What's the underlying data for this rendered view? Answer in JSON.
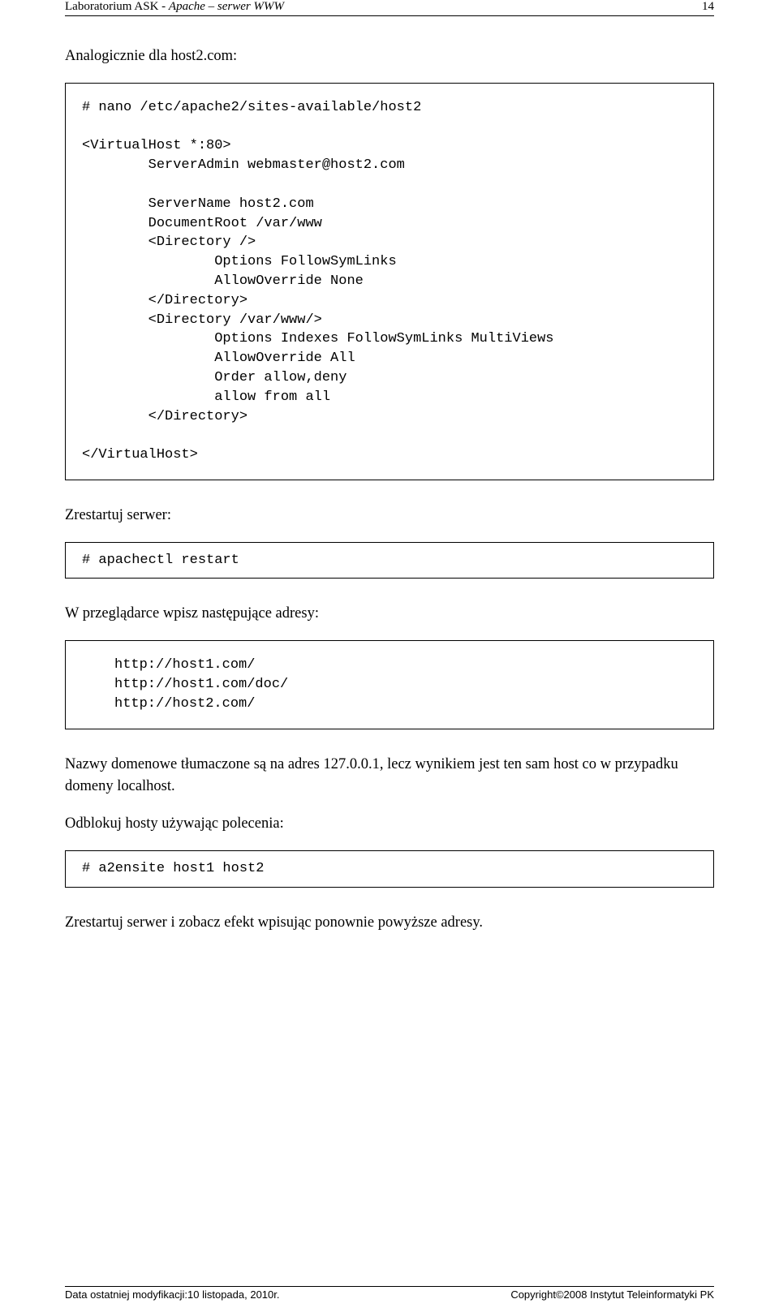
{
  "header": {
    "left_plain": "Laboratorium ASK  - ",
    "left_italic": "Apache – serwer WWW",
    "page_number": "14"
  },
  "p1": "Analogicznie dla host2.com:",
  "code1": "# nano /etc/apache2/sites-available/host2\n\n<VirtualHost *:80>\n        ServerAdmin webmaster@host2.com\n\n        ServerName host2.com\n        DocumentRoot /var/www\n        <Directory />\n                Options FollowSymLinks\n                AllowOverride None\n        </Directory>\n        <Directory /var/www/>\n                Options Indexes FollowSymLinks MultiViews\n                AllowOverride All\n                Order allow,deny\n                allow from all\n        </Directory>\n\n</VirtualHost>",
  "p2": "Zrestartuj serwer:",
  "code2": "# apachectl restart",
  "p3": "W przeglądarce wpisz następujące adresy:",
  "code3": "http://host1.com/\nhttp://host1.com/doc/\nhttp://host2.com/",
  "p4": "Nazwy domenowe tłumaczone są na adres 127.0.0.1, lecz wynikiem jest ten sam host co w przypadku domeny localhost.",
  "p5": "Odblokuj hosty używając polecenia:",
  "code4": "# a2ensite host1 host2",
  "p6": "Zrestartuj serwer i zobacz efekt wpisując ponownie powyższe adresy.",
  "footer": {
    "left": "Data ostatniej modyfikacji:10 listopada, 2010r.",
    "right": "Copyright©2008 Instytut Teleinformatyki PK"
  }
}
